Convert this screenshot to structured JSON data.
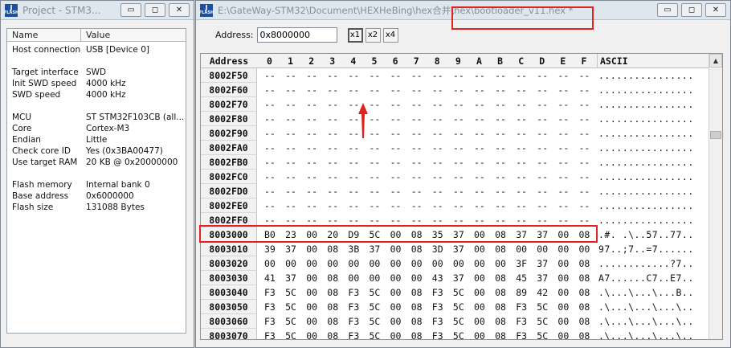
{
  "project": {
    "title": "Project - STM3...",
    "col_name": "Name",
    "col_value": "Value",
    "rows": [
      {
        "k": "Host connection",
        "v": "USB [Device 0]"
      },
      {
        "k": "",
        "v": ""
      },
      {
        "k": "Target interface",
        "v": "SWD"
      },
      {
        "k": "Init SWD speed",
        "v": "4000 kHz"
      },
      {
        "k": "SWD speed",
        "v": "4000 kHz"
      },
      {
        "k": "",
        "v": ""
      },
      {
        "k": "MCU",
        "v": "ST STM32F103CB (all..."
      },
      {
        "k": "Core",
        "v": "Cortex-M3"
      },
      {
        "k": "Endian",
        "v": "Little"
      },
      {
        "k": "Check core ID",
        "v": "Yes (0x3BA00477)"
      },
      {
        "k": "Use target RAM",
        "v": "20 KB @ 0x20000000"
      },
      {
        "k": "",
        "v": ""
      },
      {
        "k": "Flash memory",
        "v": "Internal bank 0"
      },
      {
        "k": "Base address",
        "v": "0x6000000"
      },
      {
        "k": "Flash size",
        "v": "131088 Bytes"
      }
    ]
  },
  "hex": {
    "title": "E:\\GateWay-STM32\\Document\\HEXHeBing\\hex合并\\hex\\bootloader_v11.hex *",
    "address_label": "Address:",
    "address_value": "0x8000000",
    "zoom": [
      "x1",
      "x2",
      "x4"
    ],
    "zoom_selected": "x1",
    "header": [
      "Address",
      "0",
      "1",
      "2",
      "3",
      "4",
      "5",
      "6",
      "7",
      "8",
      "9",
      "A",
      "B",
      "C",
      "D",
      "E",
      "F",
      "ASCII"
    ],
    "rows": [
      {
        "a": "8002F50",
        "b": [
          "--",
          "--",
          "--",
          "--",
          "--",
          "--",
          "--",
          "--",
          "--",
          "--",
          "--",
          "--",
          "--",
          "--",
          "--",
          "--"
        ],
        "t": "................"
      },
      {
        "a": "8002F60",
        "b": [
          "--",
          "--",
          "--",
          "--",
          "--",
          "--",
          "--",
          "--",
          "--",
          "--",
          "--",
          "--",
          "--",
          "--",
          "--",
          "--"
        ],
        "t": "................"
      },
      {
        "a": "8002F70",
        "b": [
          "--",
          "--",
          "--",
          "--",
          "--",
          "--",
          "--",
          "--",
          "--",
          "--",
          "--",
          "--",
          "--",
          "--",
          "--",
          "--"
        ],
        "t": "................"
      },
      {
        "a": "8002F80",
        "b": [
          "--",
          "--",
          "--",
          "--",
          "--",
          "--",
          "--",
          "--",
          "--",
          "--",
          "--",
          "--",
          "--",
          "--",
          "--",
          "--"
        ],
        "t": "................"
      },
      {
        "a": "8002F90",
        "b": [
          "--",
          "--",
          "--",
          "--",
          "--",
          "--",
          "--",
          "--",
          "--",
          "--",
          "--",
          "--",
          "--",
          "--",
          "--",
          "--"
        ],
        "t": "................"
      },
      {
        "a": "8002FA0",
        "b": [
          "--",
          "--",
          "--",
          "--",
          "--",
          "--",
          "--",
          "--",
          "--",
          "--",
          "--",
          "--",
          "--",
          "--",
          "--",
          "--"
        ],
        "t": "................"
      },
      {
        "a": "8002FB0",
        "b": [
          "--",
          "--",
          "--",
          "--",
          "--",
          "--",
          "--",
          "--",
          "--",
          "--",
          "--",
          "--",
          "--",
          "--",
          "--",
          "--"
        ],
        "t": "................"
      },
      {
        "a": "8002FC0",
        "b": [
          "--",
          "--",
          "--",
          "--",
          "--",
          "--",
          "--",
          "--",
          "--",
          "--",
          "--",
          "--",
          "--",
          "--",
          "--",
          "--"
        ],
        "t": "................"
      },
      {
        "a": "8002FD0",
        "b": [
          "--",
          "--",
          "--",
          "--",
          "--",
          "--",
          "--",
          "--",
          "--",
          "--",
          "--",
          "--",
          "--",
          "--",
          "--",
          "--"
        ],
        "t": "................"
      },
      {
        "a": "8002FE0",
        "b": [
          "--",
          "--",
          "--",
          "--",
          "--",
          "--",
          "--",
          "--",
          "--",
          "--",
          "--",
          "--",
          "--",
          "--",
          "--",
          "--"
        ],
        "t": "................"
      },
      {
        "a": "8002FF0",
        "b": [
          "--",
          "--",
          "--",
          "--",
          "--",
          "--",
          "--",
          "--",
          "--",
          "--",
          "--",
          "--",
          "--",
          "--",
          "--",
          "--"
        ],
        "t": "................"
      },
      {
        "a": "8003000",
        "b": [
          "B0",
          "23",
          "00",
          "20",
          "D9",
          "5C",
          "00",
          "08",
          "35",
          "37",
          "00",
          "08",
          "37",
          "37",
          "00",
          "08"
        ],
        "t": ".#. .\\..57..77.."
      },
      {
        "a": "8003010",
        "b": [
          "39",
          "37",
          "00",
          "08",
          "3B",
          "37",
          "00",
          "08",
          "3D",
          "37",
          "00",
          "08",
          "00",
          "00",
          "00",
          "00"
        ],
        "t": "97..;7..=7......"
      },
      {
        "a": "8003020",
        "b": [
          "00",
          "00",
          "00",
          "00",
          "00",
          "00",
          "00",
          "00",
          "00",
          "00",
          "00",
          "00",
          "3F",
          "37",
          "00",
          "08"
        ],
        "t": "............?7.."
      },
      {
        "a": "8003030",
        "b": [
          "41",
          "37",
          "00",
          "08",
          "00",
          "00",
          "00",
          "00",
          "43",
          "37",
          "00",
          "08",
          "45",
          "37",
          "00",
          "08"
        ],
        "t": "A7......C7..E7.."
      },
      {
        "a": "8003040",
        "b": [
          "F3",
          "5C",
          "00",
          "08",
          "F3",
          "5C",
          "00",
          "08",
          "F3",
          "5C",
          "00",
          "08",
          "89",
          "42",
          "00",
          "08"
        ],
        "t": ".\\...\\...\\...B.."
      },
      {
        "a": "8003050",
        "b": [
          "F3",
          "5C",
          "00",
          "08",
          "F3",
          "5C",
          "00",
          "08",
          "F3",
          "5C",
          "00",
          "08",
          "F3",
          "5C",
          "00",
          "08"
        ],
        "t": ".\\...\\...\\...\\.."
      },
      {
        "a": "8003060",
        "b": [
          "F3",
          "5C",
          "00",
          "08",
          "F3",
          "5C",
          "00",
          "08",
          "F3",
          "5C",
          "00",
          "08",
          "F3",
          "5C",
          "00",
          "08"
        ],
        "t": ".\\...\\...\\...\\.."
      },
      {
        "a": "8003070",
        "b": [
          "F3",
          "5C",
          "00",
          "08",
          "F3",
          "5C",
          "00",
          "08",
          "F3",
          "5C",
          "00",
          "08",
          "F3",
          "5C",
          "00",
          "08"
        ],
        "t": ".\\...\\...\\...\\.."
      }
    ]
  },
  "colors": {
    "highlight": "#e0231e"
  },
  "icons": {
    "logo": "jlink-logo-icon",
    "minimize": "minimize-icon",
    "maximize": "maximize-icon",
    "close": "close-icon",
    "scroll_up": "scroll-up-icon",
    "arrow": "red-arrow-annotation"
  }
}
